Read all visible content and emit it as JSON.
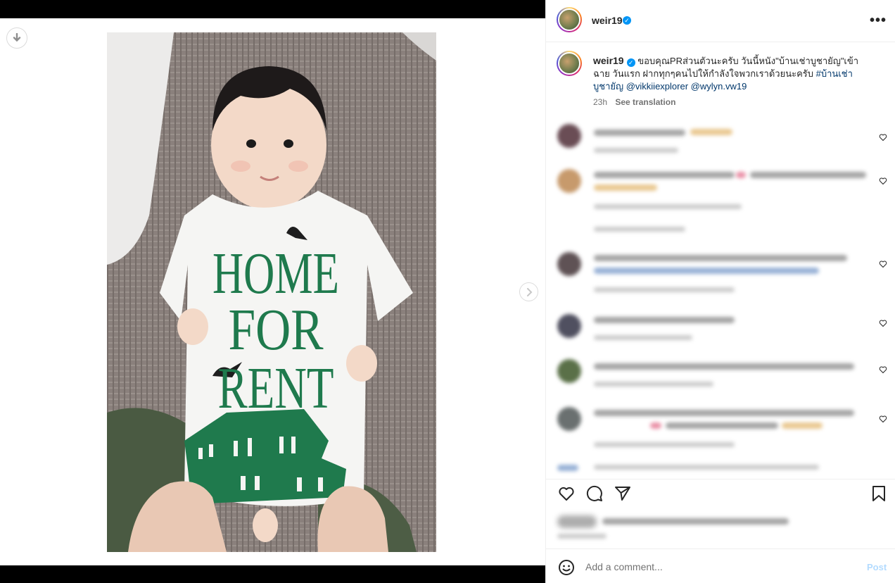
{
  "post": {
    "username": "weir19",
    "verified_mark": "✓",
    "more_icon": "more-horizontal-icon",
    "caption_part1": "ขอบคุณPRส่วนตัวนะครับ วันนี้หนัง\"บ้านเช่าบูชายัญ\"เข้าฉาย",
    "caption_part2": "วันแรก ฝากทุกๆคนไปให้กำลังใจพวกเราด้วยนะครับ",
    "hashtag": "#บ้านเช่าบูชายัญ",
    "mention1": "@vikkiiexplorer",
    "mention2": "@wylyn.vw19",
    "time": "23h",
    "see_translation": "See translation"
  },
  "photo": {
    "shirt_line1": "HOME",
    "shirt_line2": "FOR",
    "shirt_line3": "RENT"
  },
  "comment_box": {
    "placeholder": "Add a comment...",
    "post_label": "Post"
  },
  "icons": {
    "download": "download-icon",
    "next": "chevron-right-icon",
    "like": "heart-icon",
    "comment": "comment-icon",
    "share": "send-icon",
    "save": "bookmark-icon",
    "emoji": "emoji-icon"
  },
  "colors": {
    "verified": "#0095f6",
    "link": "#00376b",
    "post_button": "#b3dbff",
    "shirt_print": "#1f7a4d"
  }
}
